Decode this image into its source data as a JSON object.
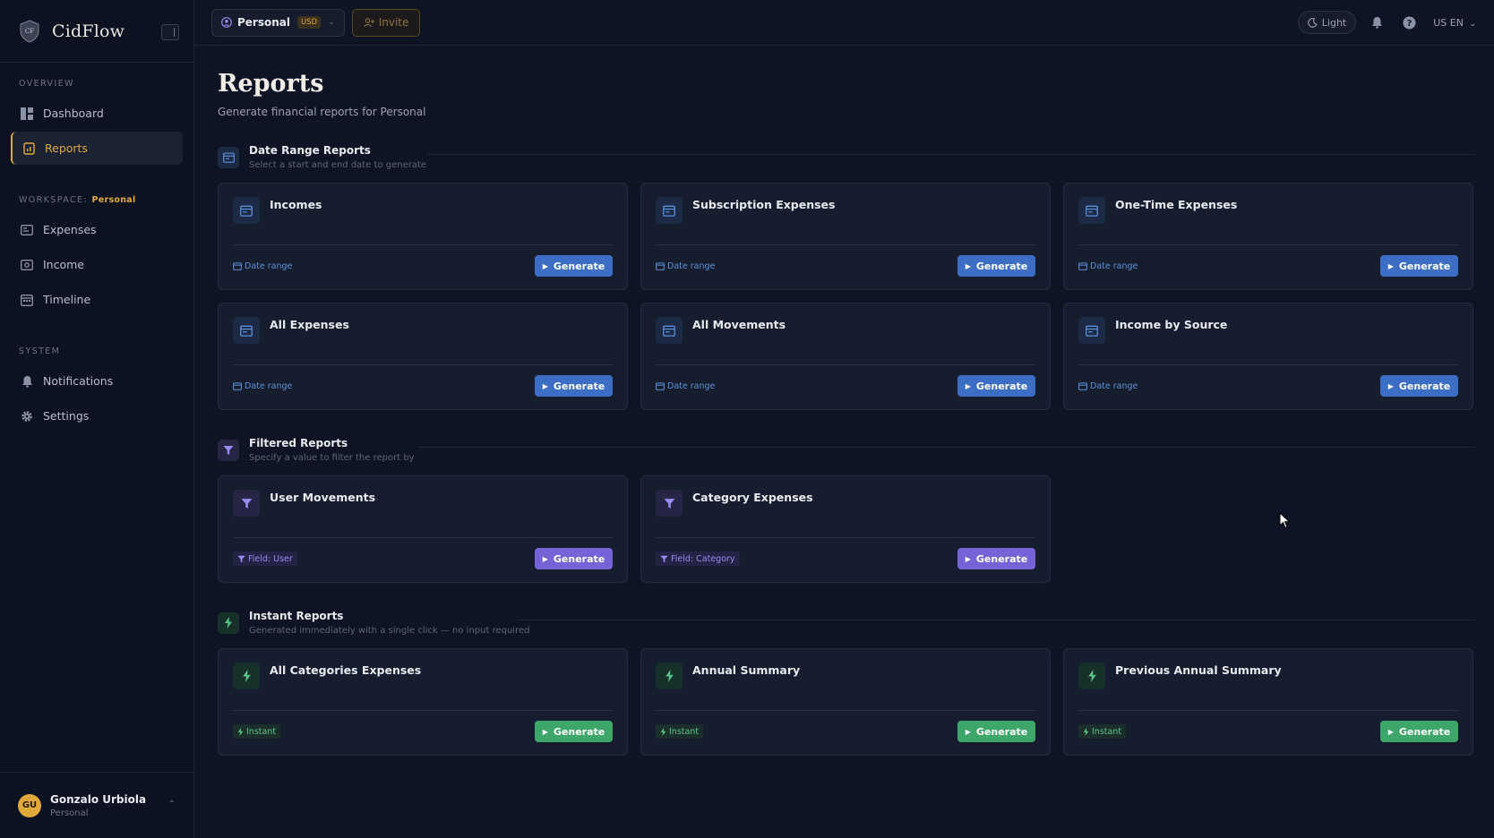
{
  "app": {
    "name": "CidFlow"
  },
  "sidebar": {
    "overview_label": "OVERVIEW",
    "overview_items": [
      {
        "label": "Dashboard",
        "icon": "dashboard-icon"
      },
      {
        "label": "Reports",
        "icon": "report-icon",
        "active": true
      }
    ],
    "workspace_label": "WORKSPACE:",
    "workspace_name": "Personal",
    "workspace_items": [
      {
        "label": "Expenses",
        "icon": "expenses-icon"
      },
      {
        "label": "Income",
        "icon": "income-icon"
      },
      {
        "label": "Timeline",
        "icon": "calendar-icon"
      }
    ],
    "system_label": "SYSTEM",
    "system_items": [
      {
        "label": "Notifications",
        "icon": "bell-icon"
      },
      {
        "label": "Settings",
        "icon": "gear-icon"
      }
    ],
    "user": {
      "initials": "GU",
      "name": "Gonzalo Urbiola",
      "workspace": "Personal"
    }
  },
  "topbar": {
    "workspace": "Personal",
    "currency": "USD",
    "invite": "Invite",
    "theme": "Light",
    "language": "US EN"
  },
  "page": {
    "title": "Reports",
    "subtitle": "Generate financial reports for Personal"
  },
  "sections": [
    {
      "title": "Date Range Reports",
      "description": "Select a start and end date to generate",
      "color": "#3b6ec4",
      "reports": [
        {
          "title": "Incomes",
          "tag": "Date range",
          "button": "Generate"
        },
        {
          "title": "Subscription Expenses",
          "tag": "Date range",
          "button": "Generate"
        },
        {
          "title": "One-Time Expenses",
          "tag": "Date range",
          "button": "Generate"
        },
        {
          "title": "All Expenses",
          "tag": "Date range",
          "button": "Generate"
        },
        {
          "title": "All Movements",
          "tag": "Date range",
          "button": "Generate"
        },
        {
          "title": "Income by Source",
          "tag": "Date range",
          "button": "Generate"
        }
      ]
    },
    {
      "title": "Filtered Reports",
      "description": "Specify a value to filter the report by",
      "color": "#7862d8",
      "reports": [
        {
          "title": "User Movements",
          "tag": "Field: User",
          "button": "Generate"
        },
        {
          "title": "Category Expenses",
          "tag": "Field: Category",
          "button": "Generate"
        }
      ]
    },
    {
      "title": "Instant Reports",
      "description": "Generated immediately with a single click — no input required",
      "color": "#3fa66a",
      "reports": [
        {
          "title": "All Categories Expenses",
          "tag": "Instant",
          "button": "Generate"
        },
        {
          "title": "Annual Summary",
          "tag": "Instant",
          "button": "Generate"
        },
        {
          "title": "Previous Annual Summary",
          "tag": "Instant",
          "button": "Generate"
        }
      ]
    }
  ]
}
